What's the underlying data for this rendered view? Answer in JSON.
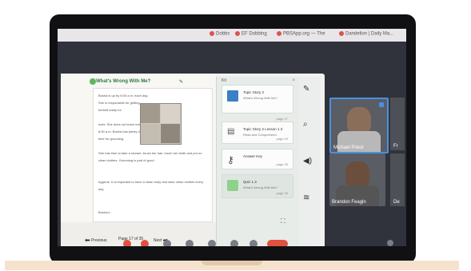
{
  "browser": {
    "bookmarks": [
      "Dobbs",
      "EF Dobbing",
      "PBSApp.org — The",
      "Dandelion | Daily Ma..."
    ]
  },
  "document": {
    "title": "What's Wrong With Me?",
    "paragraphs": [
      "Bosha is up by 6:00 a.m. each day. She is responsible for getting herself ready for",
      "work. She does not leave until 8:30 a.m. Bosha has plenty of time for grooming.",
      "She has time to take a shower, brush her hair, brush her teeth and put on clean clothes. Grooming is part of good",
      "hygiene. It is important to have a clean body and wear clean clothes every day."
    ],
    "footnote": "Bosha's...",
    "nav": {
      "prev_label": "Previous",
      "page_label": "Page 17 of 35",
      "next_label": "Next"
    }
  },
  "panel": {
    "header": "Kit",
    "cards": [
      {
        "title": "Topic Story 2",
        "subtitle": "What's Wrong With Me?",
        "page": "page 17"
      },
      {
        "title": "Topic Story 2 Lesson 1.3",
        "subtitle": "Read and Comprehend",
        "page": "page 19"
      },
      {
        "title": "Answer Key",
        "subtitle": "",
        "page": "page 25"
      },
      {
        "title": "Quiz 1.3",
        "subtitle": "What's Wrong With Me?",
        "page": "page 33"
      }
    ]
  },
  "participants": [
    {
      "name": "Michael Priest",
      "active": true
    },
    {
      "name": "Brandon Feagin",
      "active": false
    },
    {
      "name": "Fr",
      "active": false
    },
    {
      "name": "De",
      "active": false
    }
  ],
  "colors": {
    "accent": "#4a90e2",
    "danger": "#e05240",
    "title_green": "#2b7a3c"
  }
}
